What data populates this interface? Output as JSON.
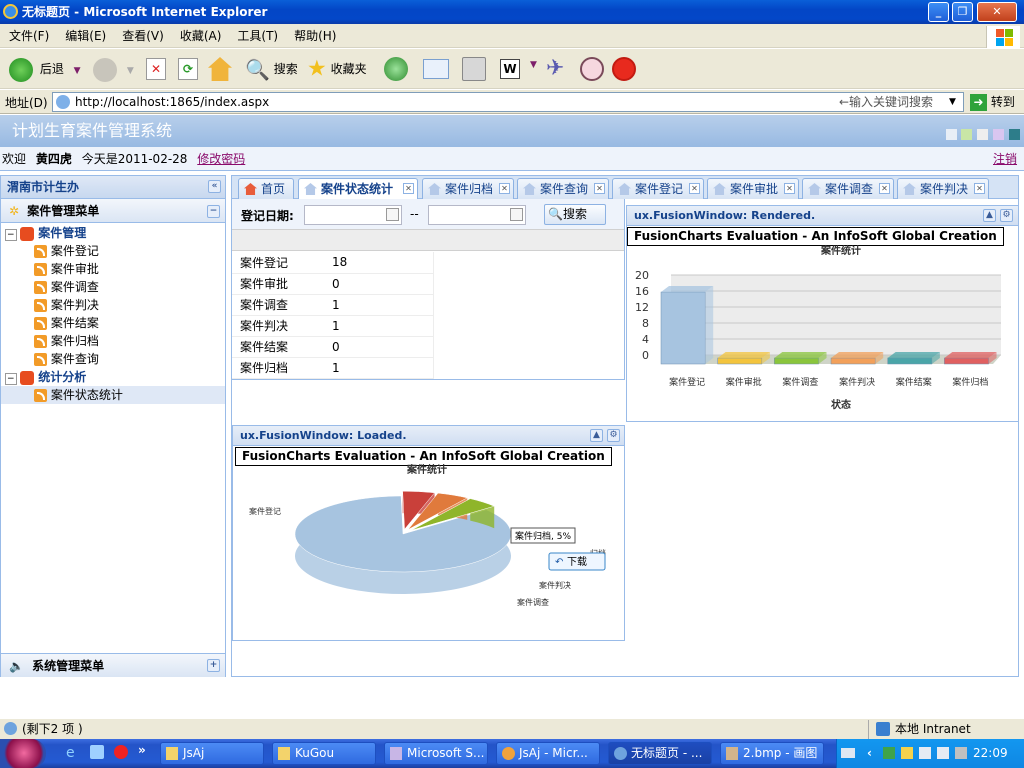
{
  "window": {
    "title": "无标题页 - Microsoft Internet Explorer"
  },
  "menu": [
    "文件(F)",
    "编辑(E)",
    "查看(V)",
    "收藏(A)",
    "工具(T)",
    "帮助(H)"
  ],
  "toolbar": {
    "back": "后退",
    "search": "搜索",
    "favorites": "收藏夹"
  },
  "address": {
    "label": "地址(D)",
    "url": "http://localhost:1865/index.aspx",
    "keyword_placeholder": "←输入关键词搜索",
    "go": "转到"
  },
  "app": {
    "title": "计划生育案件管理系统"
  },
  "userbar": {
    "welcome": "欢迎",
    "username": "黄四虎",
    "date_text": "今天是2011-02-28",
    "change_password": "修改密码",
    "logout": "注销"
  },
  "left": {
    "panel_title": "渭南市计生办",
    "menu_title": "案件管理菜单",
    "groups": [
      {
        "label": "案件管理",
        "items": [
          "案件登记",
          "案件审批",
          "案件调查",
          "案件判决",
          "案件结案",
          "案件归档",
          "案件查询"
        ]
      },
      {
        "label": "统计分析",
        "items": [
          "案件状态统计"
        ]
      }
    ],
    "system_menu": "系统管理菜单"
  },
  "tabs": [
    "首页",
    "案件状态统计",
    "案件归档",
    "案件查询",
    "案件登记",
    "案件审批",
    "案件调查",
    "案件判决"
  ],
  "search": {
    "label": "登记日期:",
    "sep": "--",
    "button": "搜索"
  },
  "stats": [
    {
      "name": "案件登记",
      "count": "18"
    },
    {
      "name": "案件审批",
      "count": "0"
    },
    {
      "name": "案件调查",
      "count": "1"
    },
    {
      "name": "案件判决",
      "count": "1"
    },
    {
      "name": "案件结案",
      "count": "0"
    },
    {
      "name": "案件归档",
      "count": "1"
    }
  ],
  "window_bar": {
    "title": "ux.FusionWindow: Rendered."
  },
  "window_pie": {
    "title": "ux.FusionWindow: Loaded."
  },
  "eval_banner": "FusionCharts Evaluation - An InfoSoft Global Creation",
  "chart_data": [
    {
      "type": "bar",
      "title": "案件统计",
      "xlabel": "状态",
      "categories": [
        "案件登记",
        "案件审批",
        "案件调查",
        "案件判决",
        "案件结案",
        "案件归档"
      ],
      "values": [
        18,
        0,
        1,
        1,
        0,
        1
      ],
      "yticks": [
        "20",
        "16",
        "12",
        "8",
        "4",
        "0"
      ],
      "ylim": [
        0,
        20
      ],
      "colors": [
        "#a7c4e0",
        "#f3c43d",
        "#8ac53c",
        "#f2a05a",
        "#4aa5a8",
        "#e06060"
      ]
    },
    {
      "type": "pie",
      "title": "案件统计",
      "categories": [
        "案件登记",
        "案件归档",
        "案件判决",
        "案件调查"
      ],
      "values": [
        18,
        1,
        1,
        1
      ],
      "labels": [
        "案件登记",
        "归档",
        "案件判决",
        "案件调查"
      ],
      "tooltip": "案件归档, 5%",
      "download": "下载",
      "colors": [
        "#a7c4e0",
        "#c9403a",
        "#e07a3c",
        "#8fb52a"
      ]
    }
  ],
  "status": {
    "left": "(剩下2 项 )",
    "zone": "本地 Intranet"
  },
  "taskbar": {
    "items": [
      "JsAj",
      "KuGou",
      "Microsoft S...",
      "JsAj - Micr...",
      "无标题页 - ...",
      "2.bmp - 画图"
    ],
    "time": "22:09"
  }
}
